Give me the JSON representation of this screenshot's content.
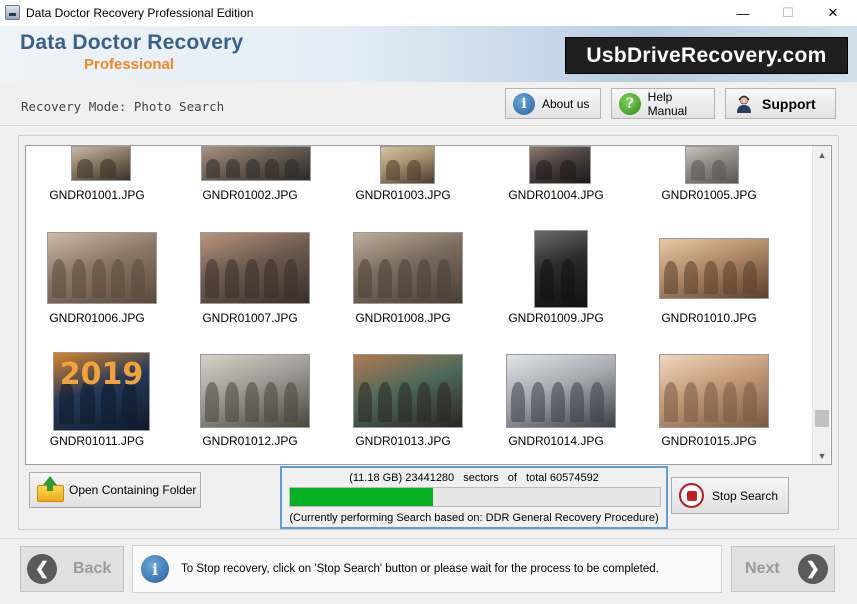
{
  "window": {
    "title": "Data Doctor Recovery Professional Edition",
    "minimize_glyph": "—",
    "maximize_glyph": "☐",
    "close_glyph": "✕"
  },
  "brand": {
    "title": "Data Doctor Recovery",
    "subtitle": "Professional",
    "url": "UsbDriveRecovery.com"
  },
  "toolbar": {
    "mode_label": "Recovery Mode: Photo Search",
    "about_label": "About us",
    "help_label": "Help Manual",
    "support_label": "Support"
  },
  "thumbnails": [
    {
      "name": "GNDR01001.JPG"
    },
    {
      "name": "GNDR01002.JPG"
    },
    {
      "name": "GNDR01003.JPG"
    },
    {
      "name": "GNDR01004.JPG"
    },
    {
      "name": "GNDR01005.JPG"
    },
    {
      "name": "GNDR01006.JPG"
    },
    {
      "name": "GNDR01007.JPG"
    },
    {
      "name": "GNDR01008.JPG"
    },
    {
      "name": "GNDR01009.JPG"
    },
    {
      "name": "GNDR01010.JPG"
    },
    {
      "name": "GNDR01011.JPG",
      "caption": "2019"
    },
    {
      "name": "GNDR01012.JPG"
    },
    {
      "name": "GNDR01013.JPG"
    },
    {
      "name": "GNDR01014.JPG"
    },
    {
      "name": "GNDR01015.JPG"
    }
  ],
  "actions": {
    "open_folder_label": "Open Containing Folder",
    "stop_label": "Stop Search"
  },
  "progress": {
    "size_text": "(11.18 GB) 23441280",
    "sectors_text": "sectors",
    "of_text": "of",
    "total_text": "total 60574592",
    "fraction": 0.387,
    "status_text": "(Currently performing Search based on:  DDR General Recovery Procedure)"
  },
  "footer": {
    "back_label": "Back",
    "next_label": "Next",
    "info_text": "To Stop recovery, click on 'Stop Search' button or please wait for the process to be completed."
  }
}
